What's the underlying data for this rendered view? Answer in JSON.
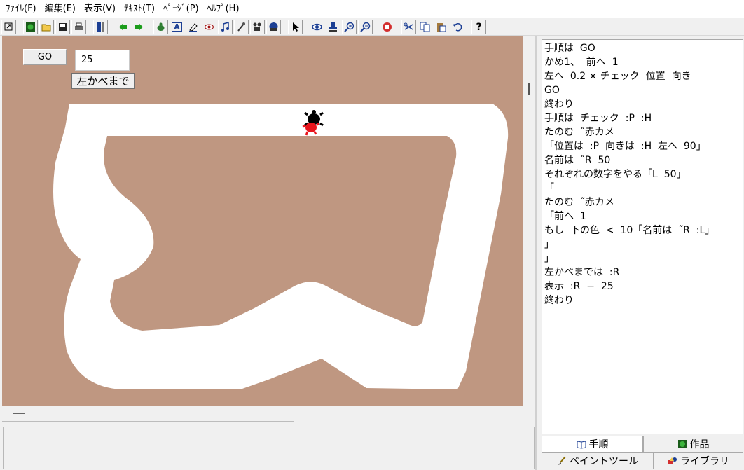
{
  "menu": [
    "ﾌｧｲﾙ(F)",
    "編集(E)",
    "表示(V)",
    "ﾃｷｽﾄ(T)",
    "ﾍﾟｰｼﾞ(P)",
    "ﾍﾙﾌﾟ(H)"
  ],
  "toolbar": {
    "text_tool_label": "A",
    "help_label": "?"
  },
  "canvas": {
    "go_button": "GO",
    "value_field": "25",
    "left_wall_button": "左かべまで"
  },
  "editor": {
    "lines": [
      "手順は  GO",
      "かめ1、  前へ  1",
      "左へ  0.2 × チェック  位置  向き",
      "GO",
      "終わり",
      "手順は  チェック  :P  :H",
      "たのむ  ˝赤カメ",
      "「位置は  :P  向きは  :H  左へ  90」",
      "名前は  ˝R  50",
      "それぞれの数字をやる「L  50」",
      "「",
      "たのむ  ˝赤カメ",
      "「前へ  1",
      "もし  下の色  <  10「名前は  ˝R  :L」",
      "」",
      "」",
      "左かべまでは  :R",
      "表示  :R  −  25",
      "終わり"
    ]
  },
  "tabs": {
    "procedure": "手順",
    "works": "作品",
    "paint_tool": "ペイントツール",
    "library": "ライブラリ"
  },
  "colors": {
    "canvas_background": "#bf9781",
    "track": "#ffffff",
    "black_turtle": "#000000",
    "red_turtle": "#e8141c"
  }
}
